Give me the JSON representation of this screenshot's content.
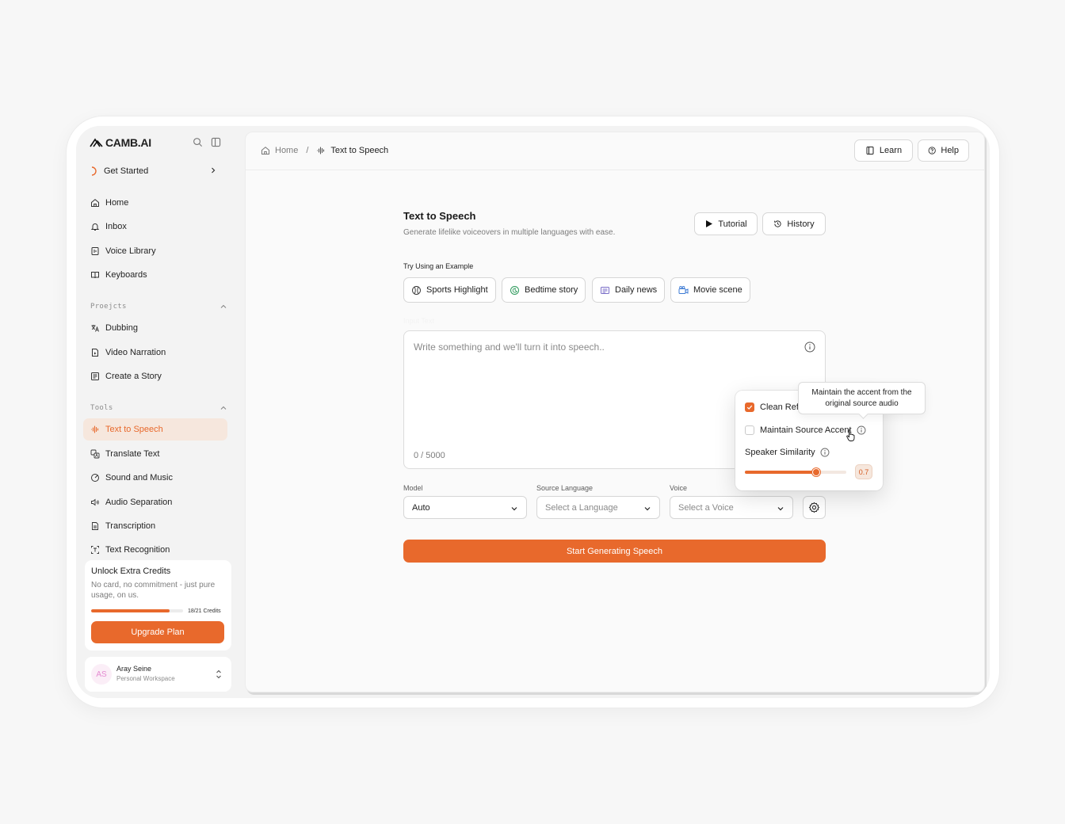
{
  "app": {
    "brand": "CAMB.AI",
    "accent": "#e8692c"
  },
  "sidebar": {
    "get_started": "Get Started",
    "main_items": [
      {
        "label": "Home",
        "icon": "home-icon"
      },
      {
        "label": "Inbox",
        "icon": "bell-icon"
      },
      {
        "label": "Voice Library",
        "icon": "voice-library-icon"
      },
      {
        "label": "Keyboards",
        "icon": "book-icon"
      }
    ],
    "projects_label": "Proejcts",
    "project_items": [
      {
        "label": "Dubbing",
        "icon": "dubbing-icon"
      },
      {
        "label": "Video Narration",
        "icon": "video-narration-icon"
      },
      {
        "label": "Create a Story",
        "icon": "story-icon"
      }
    ],
    "tools_label": "Tools",
    "tool_items": [
      {
        "label": "Text to Speech",
        "icon": "waveform-icon"
      },
      {
        "label": "Translate Text",
        "icon": "translate-icon"
      },
      {
        "label": "Sound and Music",
        "icon": "music-icon"
      },
      {
        "label": "Audio Separation",
        "icon": "speaker-icon"
      },
      {
        "label": "Transcription",
        "icon": "document-icon"
      },
      {
        "label": "Text Recognition",
        "icon": "scan-text-icon"
      }
    ],
    "credits": {
      "title": "Unlock Extra Credits",
      "description": "No card, no commitment - just pure usage, on us.",
      "used": 18,
      "total": 21,
      "count_label": "18/21 Credits",
      "button": "Upgrade Plan"
    },
    "user": {
      "initials": "AS",
      "name": "Aray Seine",
      "workspace": "Personal Workspace"
    }
  },
  "topbar": {
    "breadcrumb_home": "Home",
    "breadcrumb_sep": "/",
    "breadcrumb_current": "Text to Speech",
    "learn": "Learn",
    "help": "Help"
  },
  "main": {
    "title": "Text to Speech",
    "subtitle": "Generate lifelike voiceovers in multiple languages with ease.",
    "tutorial": "Tutorial",
    "history": "History",
    "examples_label": "Try Using an Example",
    "examples": [
      {
        "label": "Sports Highlight",
        "icon": "ball-icon"
      },
      {
        "label": "Bedtime story",
        "icon": "moon-icon"
      },
      {
        "label": "Daily news",
        "icon": "newspaper-icon"
      },
      {
        "label": "Movie scene",
        "icon": "camera-icon"
      }
    ],
    "input_label": "Input Text",
    "input_placeholder": "Write something and we'll turn it into speech..",
    "char_count": "0 / 5000",
    "model_label": "Model",
    "model_value": "Auto",
    "source_label": "Source Language",
    "source_placeholder": "Select a Language",
    "voice_label": "Voice",
    "voice_placeholder": "Select a Voice",
    "start_button": "Start Generating Speech"
  },
  "settings_popover": {
    "clean_ref": "Clean Ref",
    "clean_ref_checked": true,
    "maintain_accent": "Maintain Source Accent",
    "maintain_accent_checked": false,
    "similarity_label": "Speaker Similarity",
    "similarity_value": 0.7,
    "similarity_display": "0.7"
  },
  "tooltip": {
    "text": "Maintain the accent from the original source audio"
  }
}
